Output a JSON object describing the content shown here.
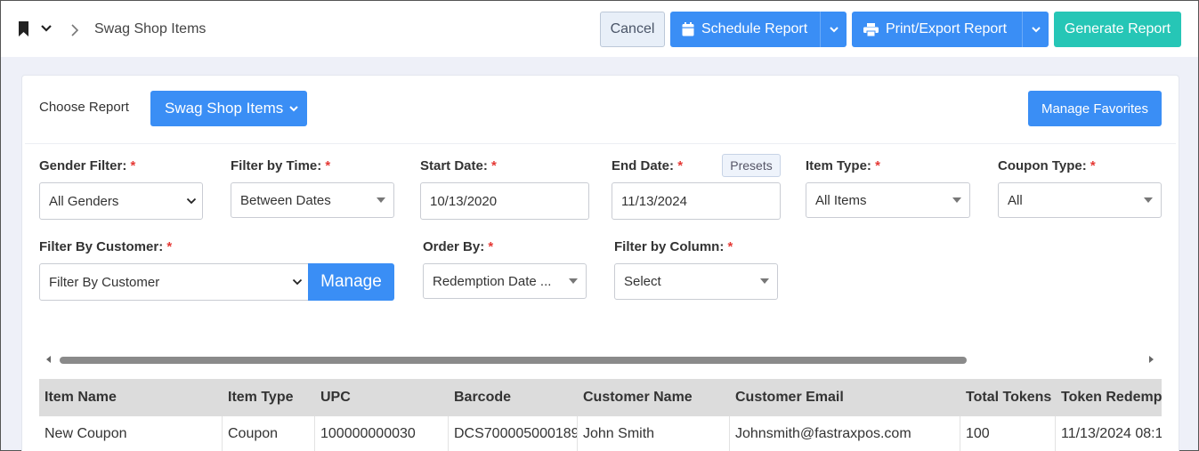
{
  "breadcrumb": {
    "current": "Swag Shop Items"
  },
  "toolbar": {
    "cancel_label": "Cancel",
    "schedule_label": "Schedule Report",
    "print_label": "Print/Export Report",
    "generate_label": "Generate Report"
  },
  "report": {
    "choose_label": "Choose Report",
    "selected": "Swag Shop Items",
    "favorites_label": "Manage Favorites"
  },
  "filters": {
    "gender": {
      "label": "Gender Filter:",
      "value": "All Genders"
    },
    "time": {
      "label": "Filter by Time:",
      "value": "Between Dates"
    },
    "start": {
      "label": "Start Date:",
      "value": "10/13/2020"
    },
    "end": {
      "label": "End Date:",
      "value": "11/13/2024"
    },
    "presets_label": "Presets",
    "item_type": {
      "label": "Item Type:",
      "value": "All Items"
    },
    "coupon_type": {
      "label": "Coupon Type:",
      "value": "All"
    },
    "customer": {
      "label": "Filter By Customer:",
      "value": "Filter By Customer",
      "manage_label": "Manage"
    },
    "order": {
      "label": "Order By:",
      "value": "Redemption Date ..."
    },
    "column": {
      "label": "Filter by Column:",
      "value": "Select"
    },
    "required_mark": "*"
  },
  "table": {
    "headers": [
      "Item Name",
      "Item Type",
      "UPC",
      "Barcode",
      "Customer Name",
      "Customer Email",
      "Total Tokens",
      "Token Redempt"
    ],
    "rows": [
      [
        "New  Coupon",
        "Coupon",
        "100000000030",
        "DCS700005000189",
        "John Smith",
        "Johnsmith@fastraxpos.com",
        "100",
        "11/13/2024 08:1"
      ]
    ]
  },
  "colors": {
    "primary": "#3a8ef5",
    "teal": "#26c6b6",
    "required": "#e53935"
  },
  "icons": [
    "bookmark-icon",
    "chevron-down-icon",
    "chevron-right-icon",
    "calendar-icon",
    "printer-icon"
  ]
}
